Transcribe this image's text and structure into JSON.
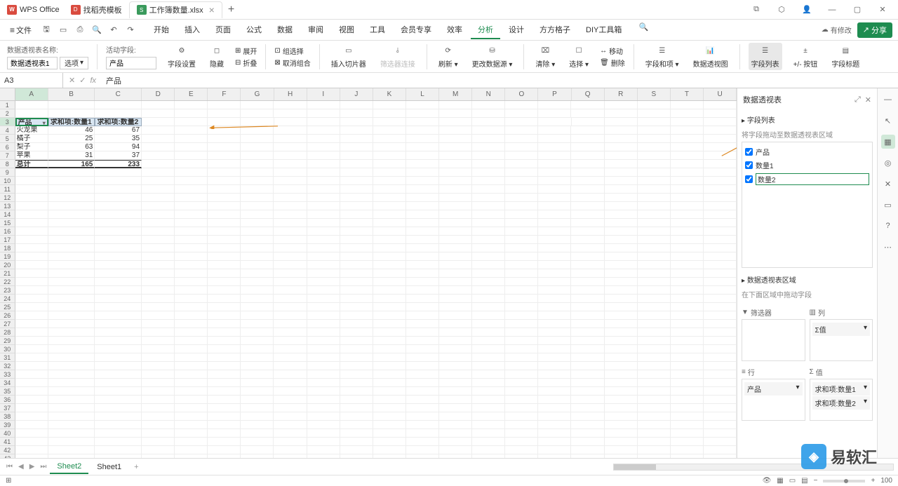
{
  "app": {
    "name": "WPS Office"
  },
  "tabs": [
    {
      "icon": "red",
      "label": "找稻壳模板"
    },
    {
      "icon": "green",
      "label": "工作簿数量.xlsx",
      "active": true
    }
  ],
  "menubar": {
    "file": "文件",
    "items": [
      "开始",
      "插入",
      "页面",
      "公式",
      "数据",
      "审阅",
      "视图",
      "工具",
      "会员专享",
      "效率",
      "分析",
      "设计",
      "方方格子",
      "DIY工具箱"
    ],
    "active": "分析",
    "status": "有修改",
    "share": "分享"
  },
  "toolbar": {
    "pivotNameLabel": "数据透视表名称:",
    "pivotName": "数据透视表1",
    "option": "选项",
    "activeFieldLabel": "活动字段:",
    "activeField": "产品",
    "fieldSettings": "字段设置",
    "hide": "隐藏",
    "expand": "展开",
    "collapse": "折叠",
    "groupSel": "组选择",
    "ungroup": "取消组合",
    "insertSlicer": "插入切片器",
    "filterConn": "筛选器连接",
    "refresh": "刷新",
    "changeSource": "更改数据源",
    "clear": "清除",
    "select": "选择",
    "move": "移动",
    "delete": "删除",
    "fieldItem": "字段和项",
    "pivotChart": "数据透视图",
    "fieldList": "字段列表",
    "plusMinusBtn": "+/- 按钮",
    "fieldHeader": "字段标题"
  },
  "formula": {
    "cellref": "A3",
    "value": "产品"
  },
  "columns": [
    "A",
    "B",
    "C",
    "D",
    "E",
    "F",
    "G",
    "H",
    "I",
    "J",
    "K",
    "L",
    "M",
    "N",
    "O",
    "P",
    "Q",
    "R",
    "S",
    "T",
    "U"
  ],
  "pivotTable": {
    "headers": [
      "产品",
      "求和项:数量1",
      "求和项:数量2"
    ],
    "rows": [
      {
        "label": "火龙果",
        "v1": 46,
        "v2": 67
      },
      {
        "label": "橘子",
        "v1": 25,
        "v2": 35
      },
      {
        "label": "梨子",
        "v1": 63,
        "v2": 94
      },
      {
        "label": "苹果",
        "v1": 31,
        "v2": 37
      }
    ],
    "total": {
      "label": "总计",
      "v1": 165,
      "v2": 233
    }
  },
  "sidePanel": {
    "title": "数据透视表",
    "fieldListTitle": "字段列表",
    "dragHint": "将字段拖动至数据透视表区域",
    "fields": [
      {
        "label": "产品",
        "checked": true
      },
      {
        "label": "数量1",
        "checked": true
      },
      {
        "label": "数量2",
        "checked": true,
        "editing": true
      }
    ],
    "areasTitle": "数据透视表区域",
    "areasHint": "在下面区域中拖动字段",
    "filter": "筛选器",
    "columns": "列",
    "rows": "行",
    "values": "值",
    "colItems": [
      "Σ值"
    ],
    "rowItems": [
      "产品"
    ],
    "valueItems": [
      "求和项:数量1",
      "求和项:数量2"
    ]
  },
  "sheets": {
    "tabs": [
      "Sheet2",
      "Sheet1"
    ],
    "active": "Sheet2"
  },
  "statusbar": {
    "zoom": "100"
  },
  "watermark": "易软汇"
}
